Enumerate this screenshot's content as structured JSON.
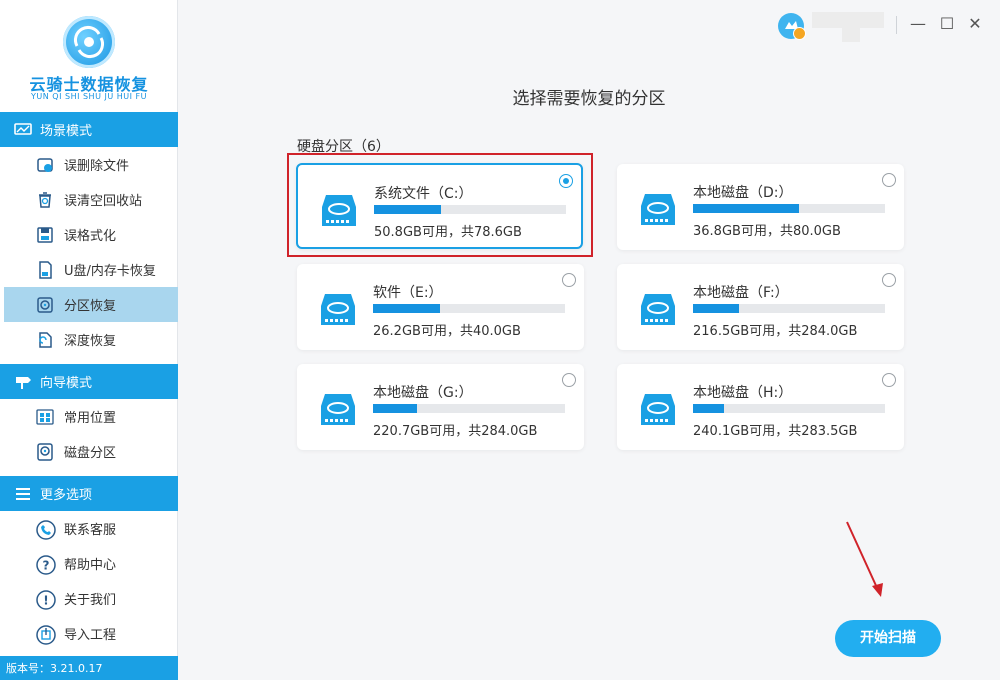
{
  "app": {
    "title": "云骑士数据恢复",
    "subtitle": "YUN QI SHI SHU JU HUI FU",
    "version": "版本号：3.21.0.17"
  },
  "sidebar": {
    "scene_mode": {
      "header": "场景模式",
      "items": [
        {
          "label": "误删除文件",
          "icon": "deleted-file-icon"
        },
        {
          "label": "误清空回收站",
          "icon": "recycle-bin-icon"
        },
        {
          "label": "误格式化",
          "icon": "format-disk-icon"
        },
        {
          "label": "U盘/内存卡恢复",
          "icon": "sd-card-icon"
        },
        {
          "label": "分区恢复",
          "icon": "partition-icon",
          "active": true
        },
        {
          "label": "深度恢复",
          "icon": "deep-recovery-icon"
        }
      ]
    },
    "guide_mode": {
      "header": "向导模式",
      "items": [
        {
          "label": "常用位置",
          "icon": "windows-icon"
        },
        {
          "label": "磁盘分区",
          "icon": "disk-partition-icon"
        }
      ]
    },
    "more_options": {
      "header": "更多选项",
      "items": [
        {
          "label": "联系客服",
          "icon": "phone-icon"
        },
        {
          "label": "帮助中心",
          "icon": "help-icon"
        },
        {
          "label": "关于我们",
          "icon": "info-icon"
        },
        {
          "label": "导入工程",
          "icon": "import-icon"
        }
      ]
    }
  },
  "titlebar": {
    "minimize": "—",
    "maximize": "☐",
    "close": "✕"
  },
  "main": {
    "title": "选择需要恢复的分区",
    "group_label": "硬盘分区（6）",
    "partitions": [
      {
        "name": "系统文件（C:）",
        "usage": "50.8GB可用，共78.6GB",
        "used_fraction": 0.35,
        "selected": true
      },
      {
        "name": "本地磁盘（D:）",
        "usage": "36.8GB可用，共80.0GB",
        "used_fraction": 0.55,
        "selected": false
      },
      {
        "name": "软件（E:）",
        "usage": "26.2GB可用，共40.0GB",
        "used_fraction": 0.35,
        "selected": false
      },
      {
        "name": "本地磁盘（F:）",
        "usage": "216.5GB可用，共284.0GB",
        "used_fraction": 0.24,
        "selected": false
      },
      {
        "name": "本地磁盘（G:）",
        "usage": "220.7GB可用，共284.0GB",
        "used_fraction": 0.23,
        "selected": false
      },
      {
        "name": "本地磁盘（H:）",
        "usage": "240.1GB可用，共283.5GB",
        "used_fraction": 0.16,
        "selected": false
      }
    ],
    "start_button": "开始扫描"
  },
  "colors": {
    "accent": "#1aa0e4",
    "bar_fill": "#1592e0",
    "highlight": "#d0232a",
    "start_button": "#22aef0"
  }
}
